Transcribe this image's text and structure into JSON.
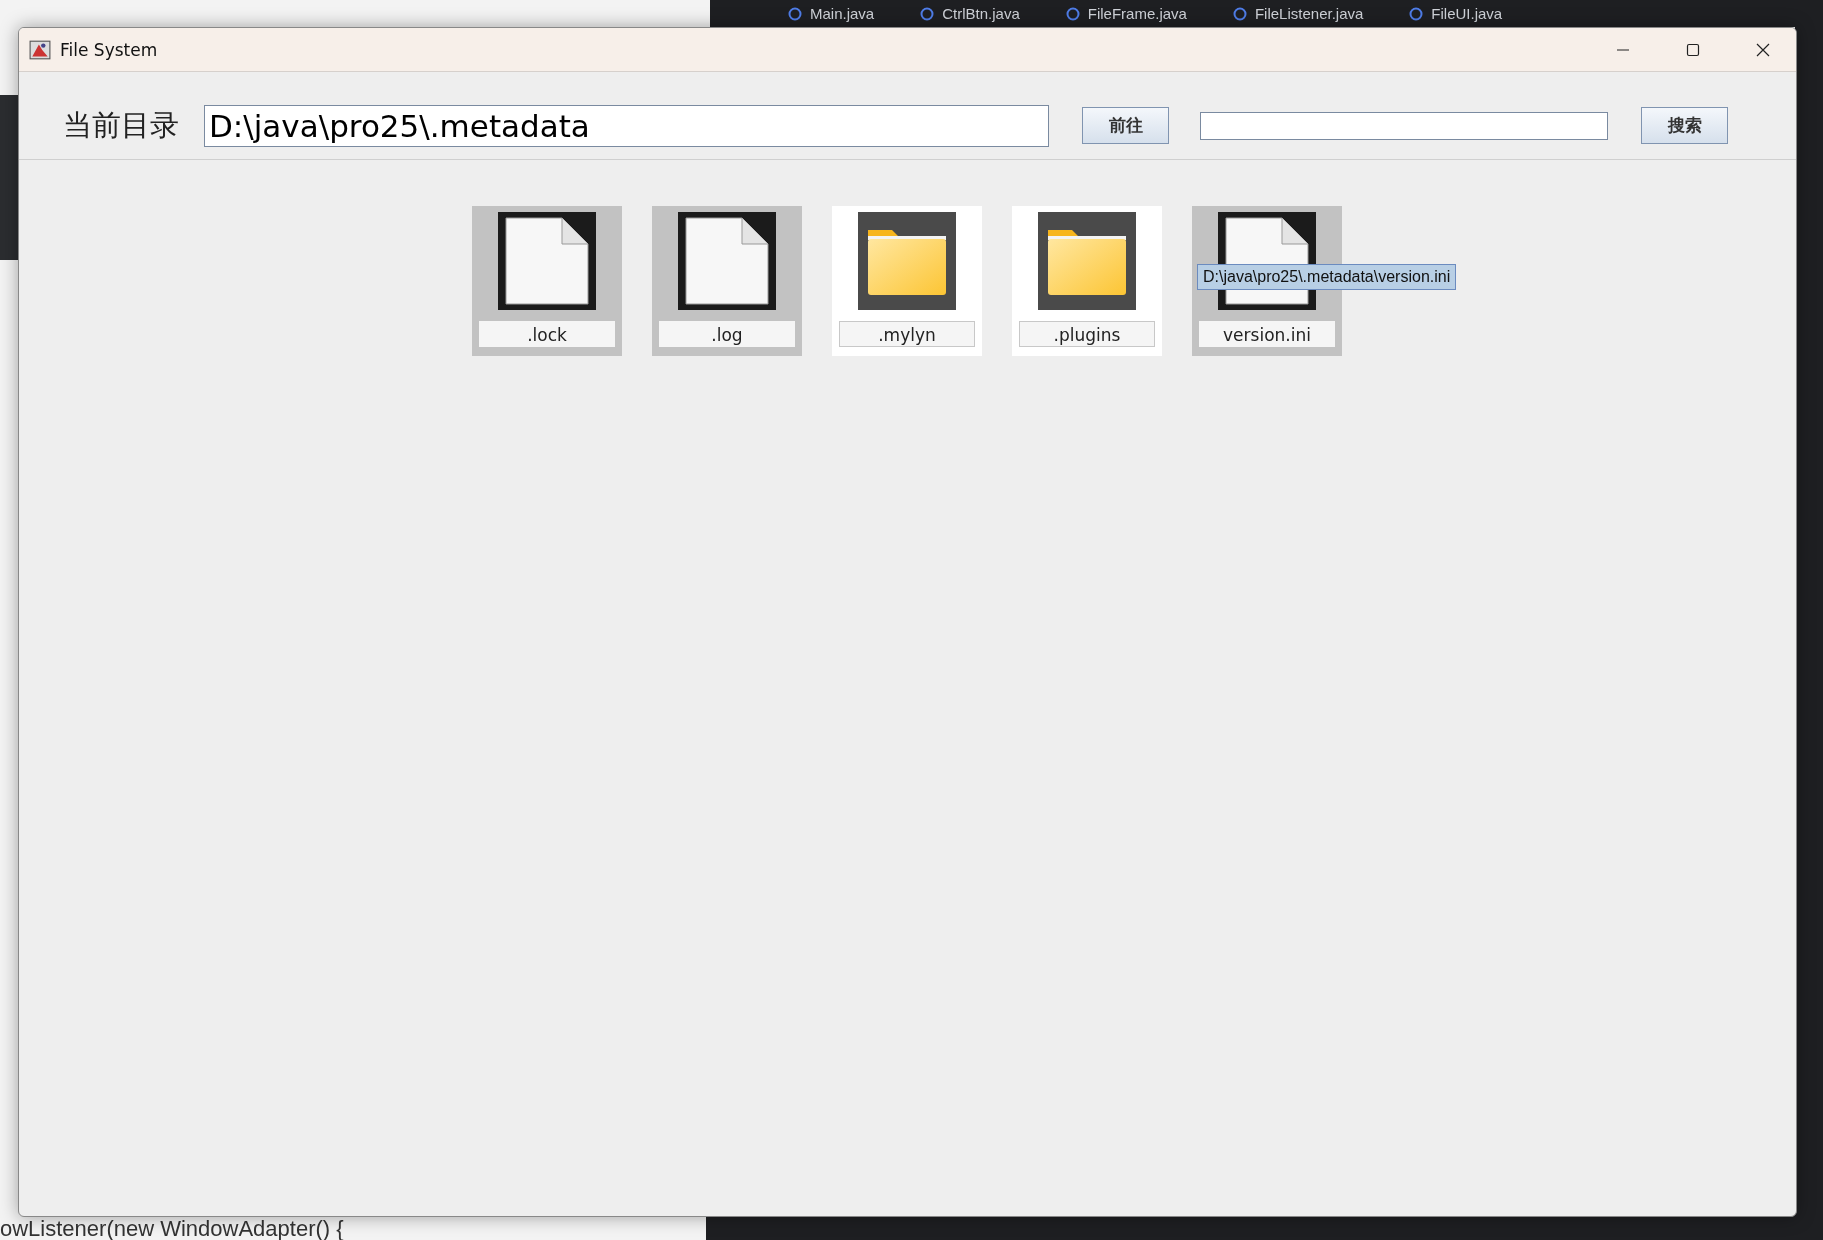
{
  "editor_tabs": [
    "Main.java",
    "CtrlBtn.java",
    "FileFrame.java",
    "FileListener.java",
    "FileUI.java"
  ],
  "background_code": "owListener(new WindowAdapter() {",
  "window": {
    "title": "File System"
  },
  "toolbar": {
    "label": "当前目录",
    "path_field": {
      "value": "D:\\java\\pro25\\.metadata"
    },
    "go_button": "前往",
    "search_button": "搜索"
  },
  "files": [
    {
      "name": ".lock",
      "kind": "file"
    },
    {
      "name": ".log",
      "kind": "file"
    },
    {
      "name": ".mylyn",
      "kind": "folder"
    },
    {
      "name": ".plugins",
      "kind": "folder"
    },
    {
      "name": "version.ini",
      "kind": "file"
    }
  ],
  "tooltip": {
    "text": "D:\\java\\pro25\\.metadata\\version.ini"
  }
}
